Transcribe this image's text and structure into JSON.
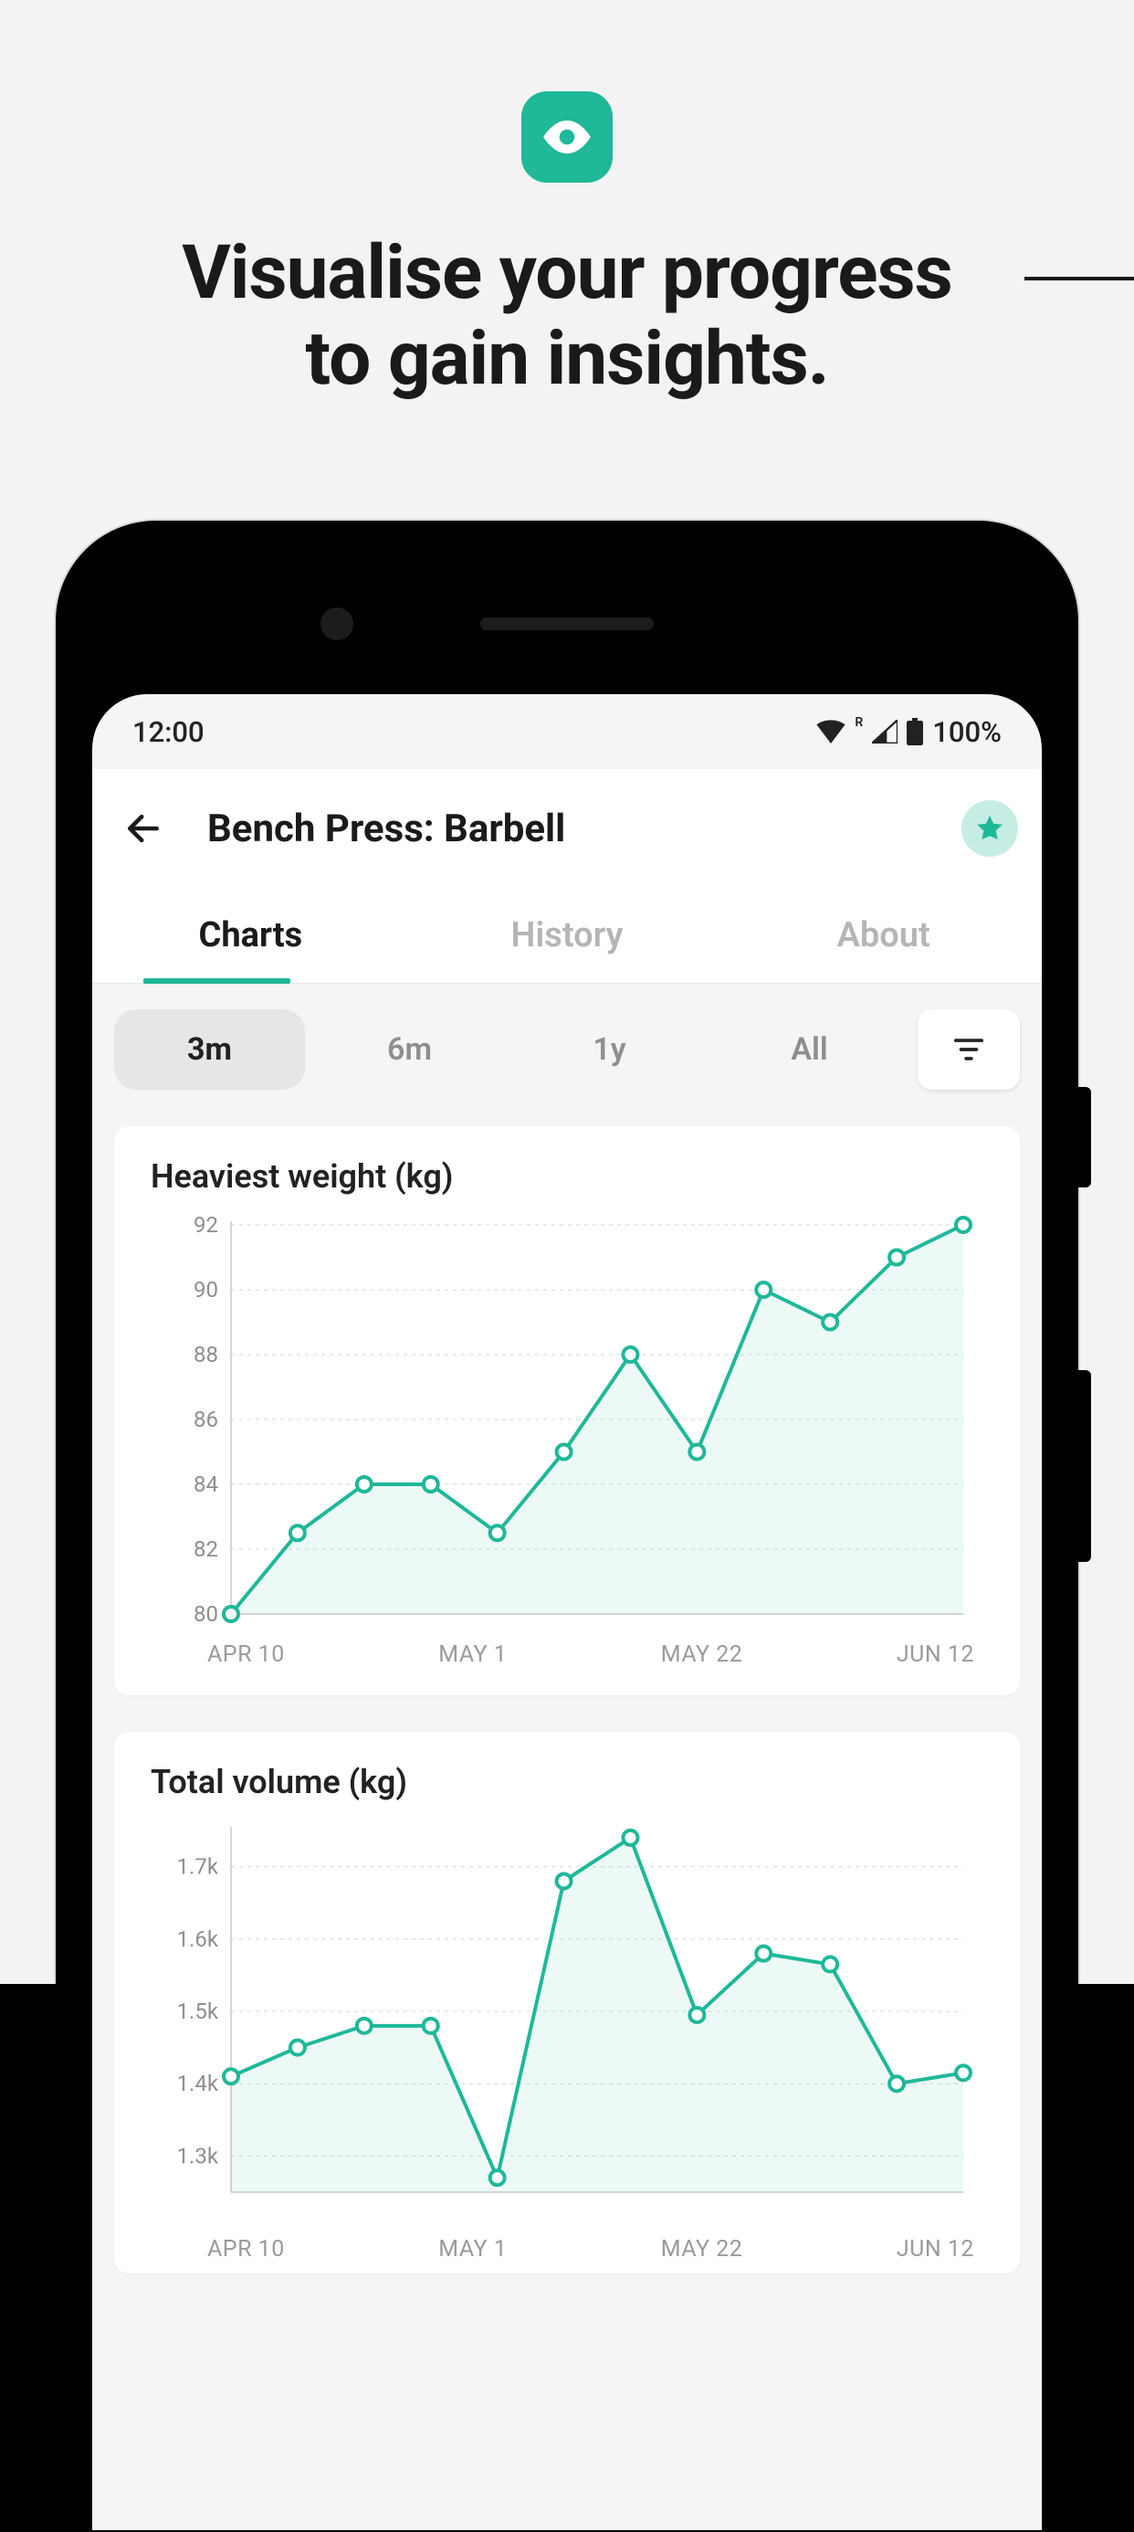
{
  "promo": {
    "title_line1": "Visualise your progress",
    "title_line2": "to gain insights."
  },
  "status": {
    "time": "12:00",
    "battery": "100%",
    "signal_badge": "R"
  },
  "header": {
    "title": "Bench Press: Barbell",
    "back_icon": "arrow-left",
    "star_icon": "star-filled"
  },
  "tabs": [
    {
      "label": "Charts",
      "active": true
    },
    {
      "label": "History",
      "active": false
    },
    {
      "label": "About",
      "active": false
    }
  ],
  "range": {
    "options": [
      {
        "label": "3m",
        "active": true
      },
      {
        "label": "6m",
        "active": false
      },
      {
        "label": "1y",
        "active": false
      },
      {
        "label": "All",
        "active": false
      }
    ],
    "filter_icon": "filter"
  },
  "charts": {
    "heaviest": {
      "title": "Heaviest weight (kg)"
    },
    "volume": {
      "title": "Total volume (kg)"
    }
  },
  "chart_data": [
    {
      "type": "line",
      "title": "Heaviest weight (kg)",
      "xlabel": "",
      "ylabel": "",
      "ylim": [
        80,
        92
      ],
      "y_ticks": [
        80,
        82,
        84,
        86,
        88,
        90,
        92
      ],
      "x_ticks": [
        "APR 10",
        "MAY 1",
        "MAY 22",
        "JUN 12"
      ],
      "x": [
        0,
        1,
        2,
        3,
        4,
        5,
        6,
        7,
        8,
        9,
        10,
        11
      ],
      "y": [
        80,
        82.5,
        84,
        84,
        82.5,
        85,
        88,
        85,
        90,
        89,
        91,
        92
      ]
    },
    {
      "type": "line",
      "title": "Total volume (kg)",
      "xlabel": "",
      "ylabel": "",
      "ylim": [
        1250,
        1750
      ],
      "y_ticks": [
        1300,
        1400,
        1500,
        1600,
        1700
      ],
      "y_tick_labels": [
        "1.3k",
        "1.4k",
        "1.5k",
        "1.6k",
        "1.7k"
      ],
      "x_ticks": [
        "APR 10",
        "MAY 1",
        "MAY 22",
        "JUN 12"
      ],
      "x": [
        0,
        1,
        2,
        3,
        4,
        5,
        6,
        7,
        8,
        9,
        10,
        11
      ],
      "y": [
        1410,
        1450,
        1480,
        1480,
        1270,
        1680,
        1740,
        1495,
        1580,
        1565,
        1400,
        1415
      ]
    }
  ],
  "colors": {
    "accent": "#1fb898",
    "accent_light": "#c6ede4"
  }
}
